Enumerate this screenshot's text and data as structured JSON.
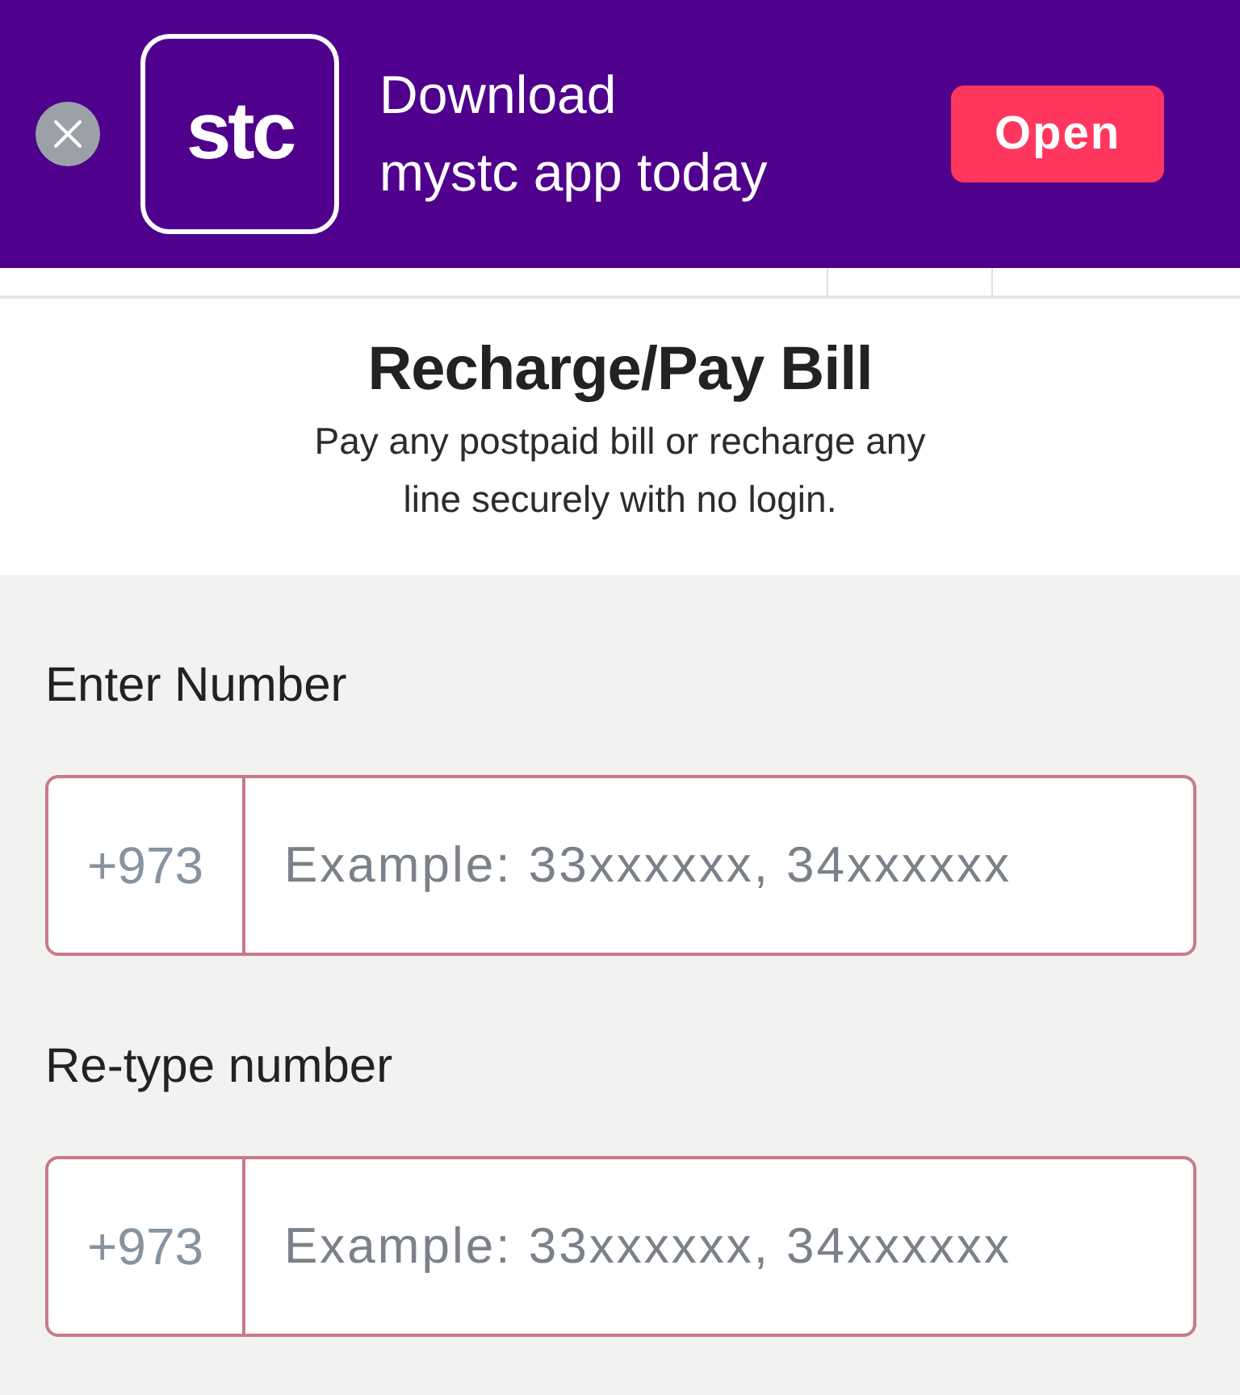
{
  "app_banner": {
    "logo_text": "stc",
    "text_lines": [
      "Download",
      "mystc app today"
    ],
    "open_button": "Open"
  },
  "header": {
    "title": "Recharge/Pay Bill",
    "subtitle": "Pay any postpaid bill or recharge any line securely with no login."
  },
  "fields": [
    {
      "label": "Enter Number",
      "prefix": "+973",
      "placeholder": "Example: 33xxxxxx, 34xxxxxx"
    },
    {
      "label": "Re-type number",
      "prefix": "+973",
      "placeholder": "Example: 33xxxxxx, 34xxxxxx"
    }
  ]
}
